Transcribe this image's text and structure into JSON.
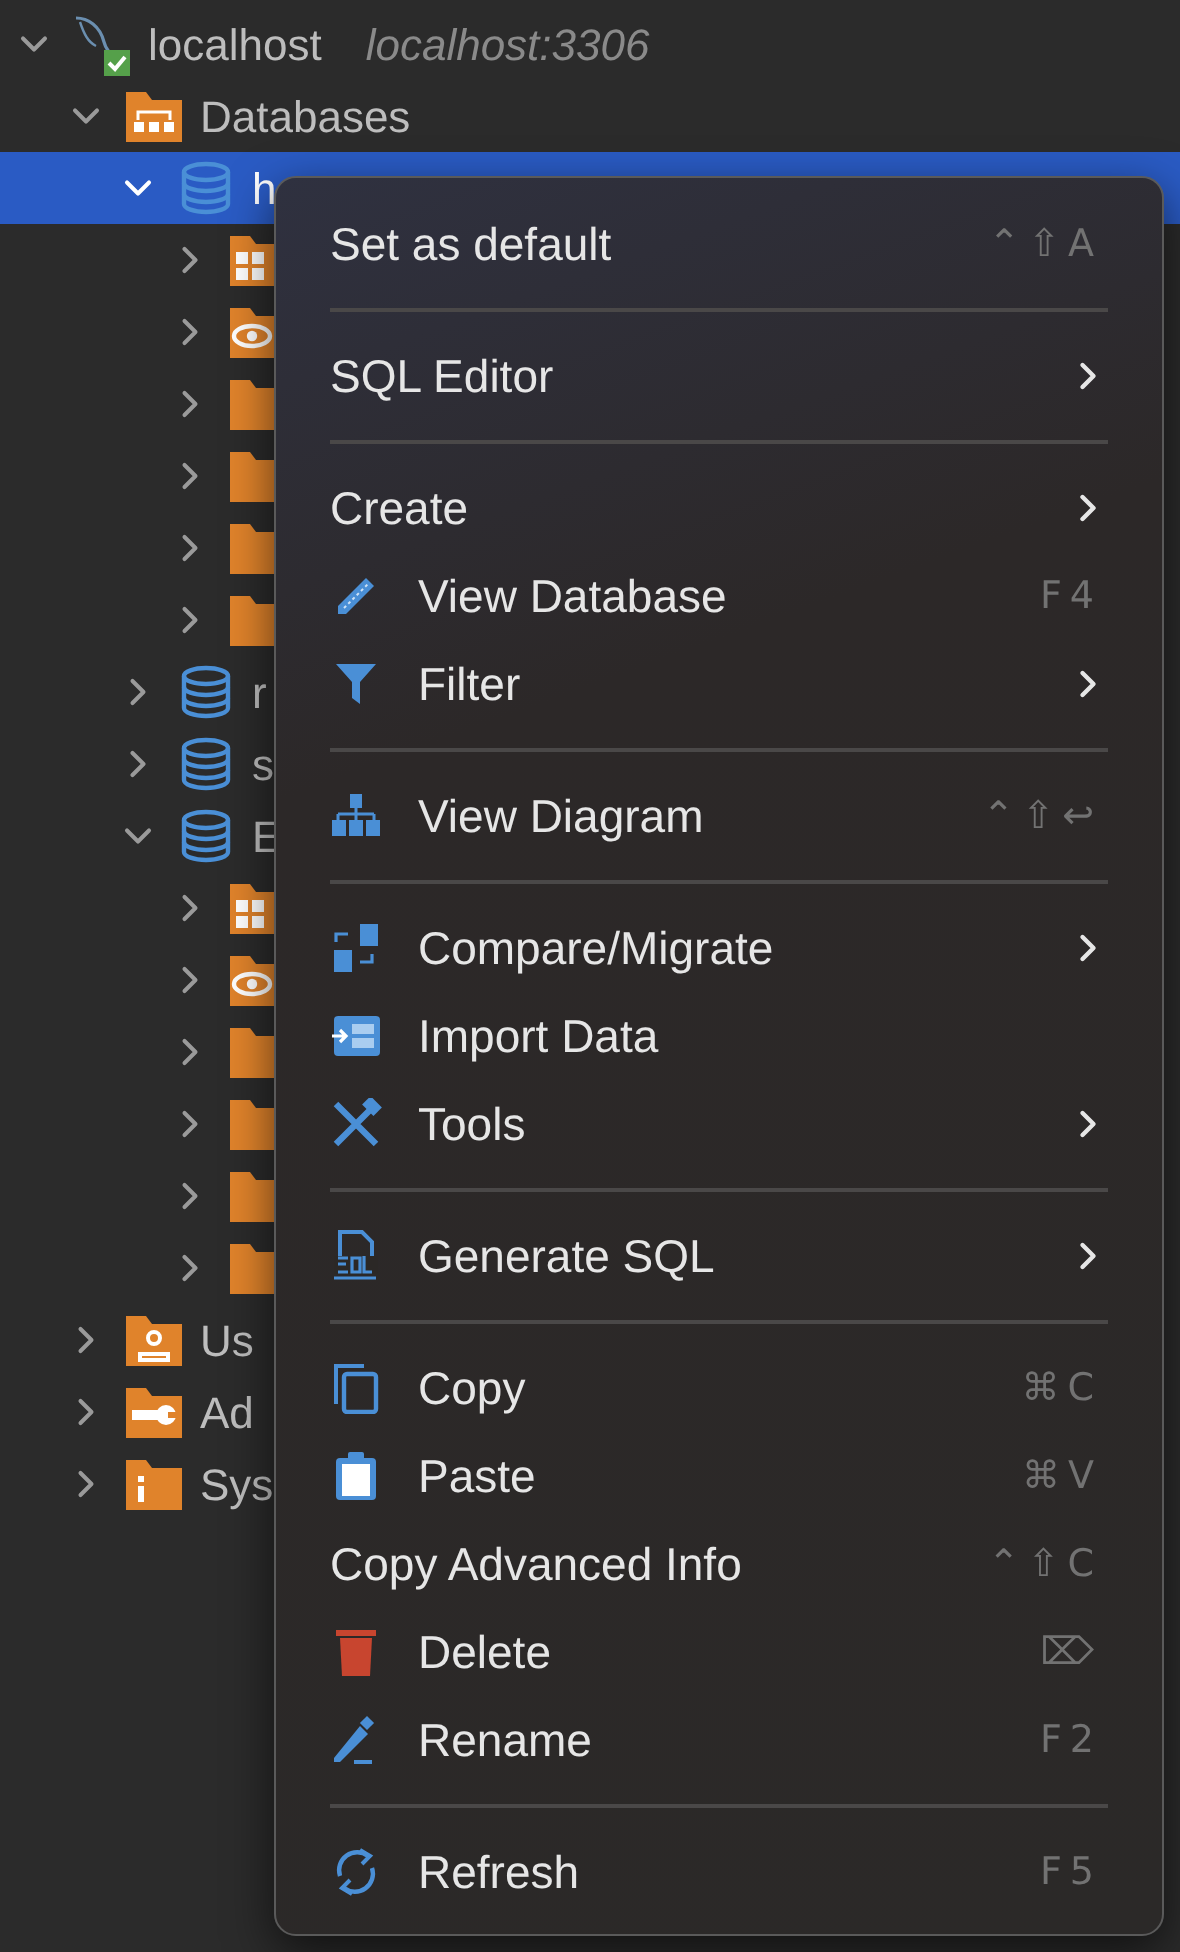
{
  "tree": [
    {
      "label": "localhost",
      "detail": "localhost:3306",
      "kind": "server",
      "expanded": true,
      "selected": false,
      "children": [
        {
          "label": "Databases",
          "kind": "databases",
          "expanded": true,
          "selected": false,
          "children": [
            {
              "label": "h",
              "kind": "database",
              "expanded": true,
              "selected": true,
              "children": [
                {
                  "kind": "tables",
                  "expanded": false,
                  "selected": false
                },
                {
                  "kind": "views",
                  "expanded": false,
                  "selected": false
                },
                {
                  "kind": "folder",
                  "expanded": false,
                  "selected": false
                },
                {
                  "kind": "folder",
                  "expanded": false,
                  "selected": false
                },
                {
                  "kind": "folder",
                  "expanded": false,
                  "selected": false
                },
                {
                  "kind": "folder",
                  "expanded": false,
                  "selected": false
                }
              ]
            },
            {
              "label": "r",
              "kind": "database",
              "expanded": false,
              "selected": false
            },
            {
              "label": "s",
              "kind": "database",
              "expanded": false,
              "selected": false
            },
            {
              "label": "E",
              "kind": "database",
              "expanded": true,
              "selected": false,
              "children": [
                {
                  "kind": "tables",
                  "expanded": false,
                  "selected": false
                },
                {
                  "kind": "views",
                  "expanded": false,
                  "selected": false
                },
                {
                  "kind": "folder",
                  "expanded": false,
                  "selected": false
                },
                {
                  "kind": "folder",
                  "expanded": false,
                  "selected": false
                },
                {
                  "kind": "folder",
                  "expanded": false,
                  "selected": false
                },
                {
                  "kind": "folder",
                  "expanded": false,
                  "selected": false
                }
              ]
            }
          ]
        },
        {
          "label": "Us",
          "kind": "users",
          "expanded": false,
          "selected": false
        },
        {
          "label": "Ad",
          "kind": "admin",
          "expanded": false,
          "selected": false
        },
        {
          "label": "Sys",
          "kind": "system",
          "expanded": false,
          "selected": false
        }
      ]
    }
  ],
  "context_menu": {
    "sections": [
      [
        {
          "label": "Set as default",
          "shortcut": "⌃⇧A"
        }
      ],
      [
        {
          "label": "SQL Editor",
          "submenu": true
        }
      ],
      [
        {
          "label": "Create",
          "submenu": true
        },
        {
          "label": "View Database",
          "kind": "pencil",
          "shortcut": "F4"
        },
        {
          "label": "Filter",
          "kind": "filter",
          "submenu": true
        }
      ],
      [
        {
          "label": "View Diagram",
          "kind": "diagram",
          "shortcut": "⌃⇧↩"
        }
      ],
      [
        {
          "label": "Compare/Migrate",
          "kind": "compare",
          "submenu": true
        },
        {
          "label": "Import Data",
          "kind": "import"
        },
        {
          "label": "Tools",
          "kind": "tools",
          "submenu": true
        }
      ],
      [
        {
          "label": "Generate SQL",
          "kind": "sql",
          "submenu": true
        }
      ],
      [
        {
          "label": "Copy",
          "kind": "copy",
          "shortcut": "⌘C"
        },
        {
          "label": "Paste",
          "kind": "paste",
          "shortcut": "⌘V"
        },
        {
          "label": "Copy Advanced Info",
          "shortcut": "⌃⇧C"
        },
        {
          "label": "Delete",
          "kind": "trash",
          "shortcut": "⌦"
        },
        {
          "label": "Rename",
          "kind": "rename",
          "shortcut": "F2"
        }
      ],
      [
        {
          "label": "Refresh",
          "kind": "refresh",
          "shortcut": "F5"
        }
      ]
    ]
  }
}
